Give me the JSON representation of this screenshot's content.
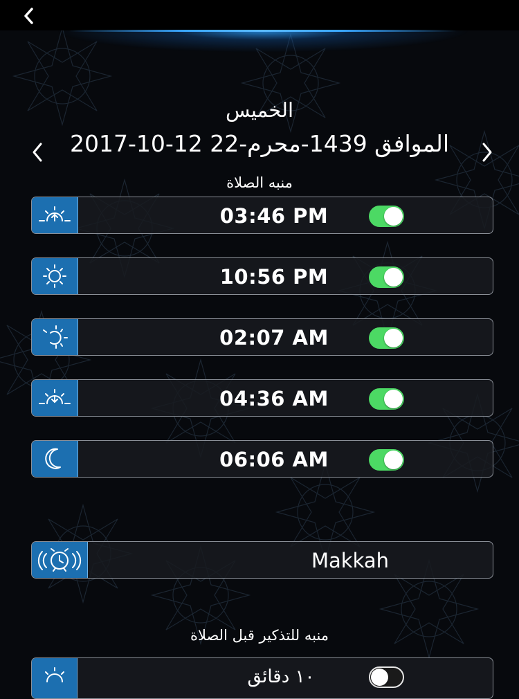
{
  "header": {
    "back_icon": "chevron-left-icon"
  },
  "date_header": {
    "day_name": "الخميس",
    "date_text": "2017-10-12 الموافق 1439-محرم-22",
    "prev_icon": "chevron-left-icon",
    "next_icon": "chevron-right-icon"
  },
  "prayer_alarms": {
    "section_title": "منبه الصلاة",
    "items": [
      {
        "icon": "sunrise-icon",
        "time": "03:46 PM",
        "enabled": true
      },
      {
        "icon": "sun-icon",
        "time": "10:56 PM",
        "enabled": true
      },
      {
        "icon": "afternoon-sun-icon",
        "time": "02:07 AM",
        "enabled": true
      },
      {
        "icon": "sunset-icon",
        "time": "04:36 AM",
        "enabled": true
      },
      {
        "icon": "crescent-moon-icon",
        "time": "06:06 AM",
        "enabled": true
      }
    ]
  },
  "location": {
    "icon": "alarm-clock-icon",
    "city": "Makkah"
  },
  "reminder": {
    "section_title": "منبه للتذكير قبل الصلاة",
    "partial_label": "١٠ دقائق",
    "enabled": false,
    "icon": "sunrise-icon"
  },
  "colors": {
    "icon_box": "#1c6fb0",
    "toggle_on": "#4cd964",
    "glow": "#3aa7ff",
    "background": "#07090d"
  }
}
